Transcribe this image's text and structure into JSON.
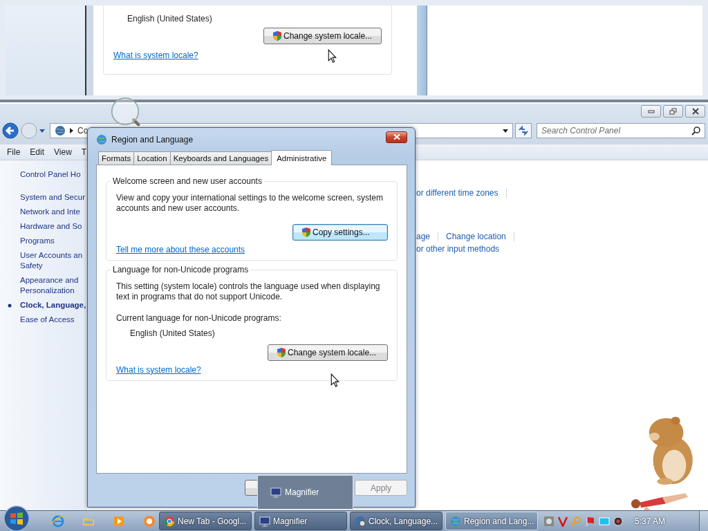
{
  "magnifier_view": {
    "value": "English (United States)",
    "button": "Change system locale...",
    "link": "What is system locale?"
  },
  "explorer": {
    "address": "Co",
    "search": {
      "placeholder": "Search Control Panel"
    },
    "menu": [
      "File",
      "Edit",
      "View",
      "T"
    ],
    "sidebar": [
      {
        "label": "Control Panel Ho",
        "selected": false
      },
      {
        "label": "System and Secur",
        "selected": false
      },
      {
        "label": "Network and Inte",
        "selected": false
      },
      {
        "label": "Hardware and So",
        "selected": false
      },
      {
        "label": "Programs",
        "selected": false
      },
      {
        "label": "User Accounts an Safety",
        "selected": false
      },
      {
        "label": "Appearance and Personalization",
        "selected": false
      },
      {
        "label": "Clock, Language,",
        "selected": true
      },
      {
        "label": "Ease of Access",
        "selected": false
      }
    ],
    "link_rows": [
      [
        "or different time zones"
      ],
      [
        "age",
        "Change location"
      ],
      [
        "or other input methods"
      ]
    ]
  },
  "dialog": {
    "title": "Region and Language",
    "tabs": [
      {
        "label": "Formats",
        "selected": false
      },
      {
        "label": "Location",
        "selected": false
      },
      {
        "label": "Keyboards and Languages",
        "selected": false
      },
      {
        "label": "Administrative",
        "selected": true
      }
    ],
    "groups": [
      {
        "title": "Welcome screen and new user accounts",
        "text": "View and copy your international settings to the welcome screen, system accounts and new user accounts.",
        "button": "Copy settings...",
        "link": "Tell me more about these accounts"
      },
      {
        "title": "Language for non-Unicode programs",
        "text": "This setting (system locale) controls the language used when displaying text in programs that do not support Unicode.",
        "current_label": "Current language for non-Unicode programs:",
        "value": "English (United States)",
        "button": "Change system locale...",
        "link": "What is system locale?"
      }
    ],
    "buttons": [
      {
        "label": "Apply",
        "disabled": true
      }
    ]
  },
  "magnifier_preview": {
    "title": "Magnifier"
  },
  "taskbar": {
    "tasks": [
      {
        "label": "New Tab - Googl...",
        "kind": "browser",
        "selected": false
      },
      {
        "label": "Magnifier",
        "kind": "magnifier",
        "selected": false
      },
      {
        "label": "Clock, Language...",
        "kind": "panel",
        "selected": false
      },
      {
        "label": "Region and Lang...",
        "kind": "region",
        "selected": true
      }
    ],
    "clock": "5:37 AM"
  }
}
